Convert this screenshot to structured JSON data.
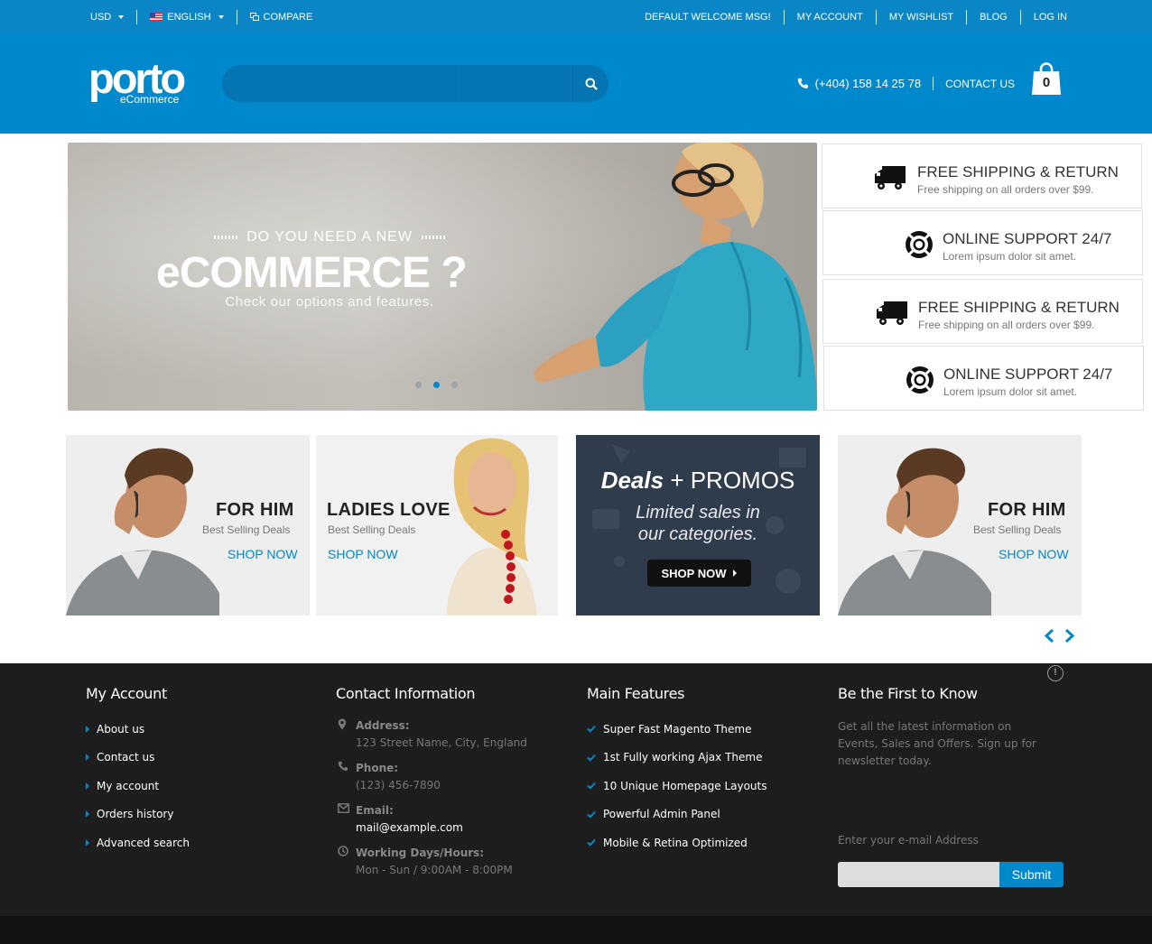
{
  "topbar": {
    "currency": "USD",
    "language": "ENGLISH",
    "compare": "COMPARE",
    "welcome": "DEFAULT WELCOME MSG!",
    "links": [
      "MY ACCOUNT",
      "MY WISHLIST",
      "BLOG",
      "LOG IN"
    ]
  },
  "header": {
    "logo_main": "porto",
    "logo_sub": "eCommerce",
    "search_placeholder": "",
    "phone": "(+404) 158 14 25 78",
    "contact_label": "CONTACT US",
    "cart_count": "0"
  },
  "hero": {
    "subtitle": "DO YOU NEED A NEW",
    "title": "eCOMMERCE ?",
    "tagline": "Check our options and features.",
    "slides": 3,
    "active_slide": 2
  },
  "features": [
    {
      "title": "FREE SHIPPING & RETURN",
      "desc": "Free shipping on all orders over $99.",
      "icon": "truck-icon"
    },
    {
      "title": "ONLINE SUPPORT 24/7",
      "desc": "Lorem ipsum dolor sit amet.",
      "icon": "lifebuoy-icon"
    },
    {
      "title": "FREE SHIPPING & RETURN",
      "desc": "Free shipping on all orders over $99.",
      "icon": "truck-icon"
    },
    {
      "title": "ONLINE SUPPORT 24/7",
      "desc": "Lorem ipsum dolor sit amet.",
      "icon": "lifebuoy-icon"
    }
  ],
  "promos": [
    {
      "title": "FOR HIM",
      "subtitle": "Best Selling Deals",
      "link": "SHOP NOW"
    },
    {
      "title": "LADIES LOVE",
      "subtitle": "Best Selling Deals",
      "link": "SHOP NOW"
    },
    {
      "title_bold": "Deals",
      "title_rest": "+ PROMOS",
      "desc_line1": "Limited sales in",
      "desc_line2": "our categories.",
      "button": "SHOP NOW"
    },
    {
      "title": "FOR HIM",
      "subtitle": "Best Selling Deals",
      "link": "SHOP NOW"
    }
  ],
  "footer": {
    "my_account": {
      "heading": "My Account",
      "links": [
        "About us",
        "Contact us",
        "My account",
        "Orders history",
        "Advanced search"
      ]
    },
    "contact": {
      "heading": "Contact Information",
      "items": [
        {
          "label": "Address:",
          "value": "123 Street Name, City, England"
        },
        {
          "label": "Phone:",
          "value": "(123) 456-7890"
        },
        {
          "label": "Email:",
          "value": "mail@example.com"
        },
        {
          "label": "Working Days/Hours:",
          "value": "Mon - Sun / 9:00AM - 8:00PM"
        }
      ]
    },
    "features": {
      "heading": "Main Features",
      "items": [
        "Super Fast Magento Theme",
        "1st Fully working Ajax Theme",
        "10 Unique Homepage Layouts",
        "Powerful Admin Panel",
        "Mobile & Retina Optimized"
      ]
    },
    "newsletter": {
      "heading": "Be the First to Know",
      "text": "Get all the latest information on Events, Sales and Offers. Sign up for newsletter today.",
      "label": "Enter your e-mail Address",
      "button": "Submit"
    }
  },
  "colors": {
    "brand": "#0088cc",
    "topbar": "#0a86c6",
    "footer": "#1d1d1d",
    "deals_bg": "#2f3c4c"
  }
}
